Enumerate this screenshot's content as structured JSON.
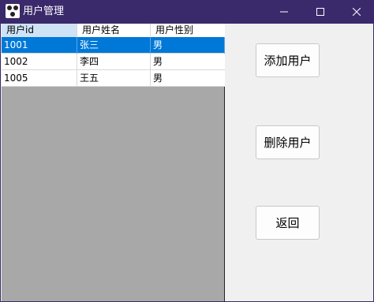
{
  "window": {
    "title": "用户管理"
  },
  "table": {
    "columns": [
      "用户id",
      "用户姓名",
      "用户性别"
    ],
    "rows": [
      {
        "id": "1001",
        "name": "张三",
        "gender": "男",
        "selected": true
      },
      {
        "id": "1002",
        "name": "李四",
        "gender": "男",
        "selected": false
      },
      {
        "id": "1005",
        "name": "王五",
        "gender": "男",
        "selected": false
      }
    ]
  },
  "actions": {
    "add": "添加用户",
    "delete": "删除用户",
    "back": "返回"
  },
  "colors": {
    "titlebar": "#3b2a6b",
    "selection": "#0078d7",
    "empty_area": "#a8a8a8"
  }
}
